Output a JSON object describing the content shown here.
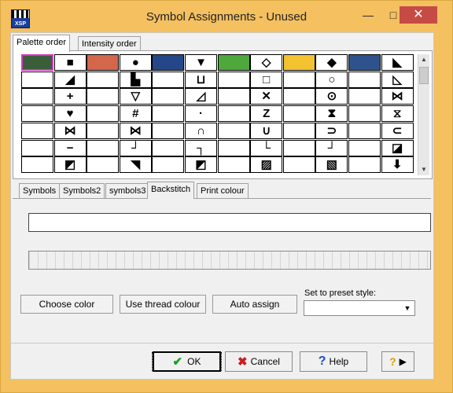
{
  "window": {
    "title": "Symbol Assignments - Unused",
    "app_icon_text": "XSP"
  },
  "titlebar": {
    "minimize": "—",
    "maximize": "□",
    "close": "✕"
  },
  "top_tabs": [
    {
      "label": "Palette order",
      "active": true
    },
    {
      "label": "Intensity order",
      "active": false
    }
  ],
  "palette_grid": {
    "columns": 12,
    "rows": [
      [
        {
          "color": "#3a5e3a",
          "selected": true
        },
        {
          "symbol": "■"
        },
        {
          "color": "#d2674c"
        },
        {
          "symbol": "●"
        },
        {
          "color": "#25478a"
        },
        {
          "symbol": "▼"
        },
        {
          "color": "#4ea83c"
        },
        {
          "symbol": "◇"
        },
        {
          "color": "#f2c230"
        },
        {
          "symbol": "◆"
        },
        {
          "color": "#2e538c"
        },
        {
          "symbol": "◣"
        }
      ],
      [
        {
          "symbol": ""
        },
        {
          "symbol": "◢"
        },
        {
          "symbol": ""
        },
        {
          "symbol": "▙"
        },
        {
          "symbol": ""
        },
        {
          "symbol": "⊔"
        },
        {
          "symbol": ""
        },
        {
          "symbol": "□"
        },
        {
          "symbol": ""
        },
        {
          "symbol": "○"
        },
        {
          "symbol": ""
        },
        {
          "symbol": "◺"
        }
      ],
      [
        {
          "symbol": ""
        },
        {
          "symbol": "+"
        },
        {
          "symbol": ""
        },
        {
          "symbol": "▽"
        },
        {
          "symbol": ""
        },
        {
          "symbol": "◿"
        },
        {
          "symbol": ""
        },
        {
          "symbol": "✕"
        },
        {
          "symbol": ""
        },
        {
          "symbol": "⊙"
        },
        {
          "symbol": ""
        },
        {
          "symbol": "⋈"
        }
      ],
      [
        {
          "symbol": ""
        },
        {
          "symbol": "♥"
        },
        {
          "symbol": ""
        },
        {
          "symbol": "#"
        },
        {
          "symbol": ""
        },
        {
          "symbol": "·"
        },
        {
          "symbol": ""
        },
        {
          "symbol": "Z"
        },
        {
          "symbol": ""
        },
        {
          "symbol": "⧗"
        },
        {
          "symbol": ""
        },
        {
          "symbol": "⧖"
        }
      ],
      [
        {
          "symbol": ""
        },
        {
          "symbol": "⋈"
        },
        {
          "symbol": ""
        },
        {
          "symbol": "⋈"
        },
        {
          "symbol": ""
        },
        {
          "symbol": "∩"
        },
        {
          "symbol": ""
        },
        {
          "symbol": "∪"
        },
        {
          "symbol": ""
        },
        {
          "symbol": "⊃"
        },
        {
          "symbol": ""
        },
        {
          "symbol": "⊂"
        }
      ],
      [
        {
          "symbol": ""
        },
        {
          "symbol": "−"
        },
        {
          "symbol": ""
        },
        {
          "symbol": "┘"
        },
        {
          "symbol": ""
        },
        {
          "symbol": "┐"
        },
        {
          "symbol": ""
        },
        {
          "symbol": "└"
        },
        {
          "symbol": ""
        },
        {
          "symbol": "┘"
        },
        {
          "symbol": ""
        },
        {
          "symbol": "◪"
        }
      ],
      [
        {
          "symbol": ""
        },
        {
          "symbol": "◩"
        },
        {
          "symbol": ""
        },
        {
          "symbol": "◥"
        },
        {
          "symbol": ""
        },
        {
          "symbol": "◩"
        },
        {
          "symbol": ""
        },
        {
          "symbol": "▨"
        },
        {
          "symbol": ""
        },
        {
          "symbol": "▧"
        },
        {
          "symbol": ""
        },
        {
          "symbol": "⬇"
        }
      ]
    ]
  },
  "scrollbar": {
    "up": "▲",
    "down": "▼"
  },
  "bottom_tabs": [
    {
      "label": "Symbols",
      "active": false
    },
    {
      "label": "Symbols2",
      "active": false
    },
    {
      "label": "symbols3",
      "active": false
    },
    {
      "label": "Backstitch",
      "active": true
    },
    {
      "label": "Print colour",
      "active": false
    }
  ],
  "backstitch": {
    "choose_color": "Choose color",
    "use_thread_colour": "Use thread colour",
    "auto_assign": "Auto assign",
    "preset_label": "Set to preset style:",
    "preset_value": "",
    "preset_arrow": "▼"
  },
  "footer": {
    "ok": "OK",
    "cancel": "Cancel",
    "help": "Help",
    "context_help_icon": "?"
  },
  "icons": {
    "ok": "check-icon",
    "cancel": "x-icon",
    "help": "question-icon",
    "context_help": "context-help-icon"
  }
}
